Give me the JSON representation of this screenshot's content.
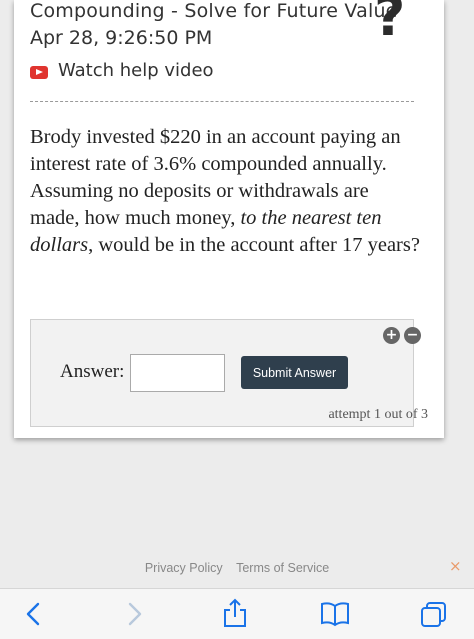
{
  "header": {
    "title": "Compounding - Solve for Future Value",
    "timestamp": "Apr 28, 9:26:50 PM",
    "help_glyph": "?",
    "watch_label": "Watch help video"
  },
  "question": {
    "part1": "Brody invested $220 in an account paying an interest rate of 3.6% compounded annually. Assuming no deposits or withdrawals are made, how much money, ",
    "emphasis": "to the nearest ten dollars",
    "part2": ", would be in the account after 17 years?"
  },
  "answer": {
    "label": "Answer:",
    "input_value": "",
    "submit_label": "Submit Answer",
    "attempt_text": "attempt 1 out of 3",
    "zoom_in_glyph": "+",
    "zoom_out_glyph": "−"
  },
  "footer": {
    "privacy_label": "Privacy Policy",
    "terms_label": "Terms of Service",
    "close_glyph": "×"
  },
  "colors": {
    "youtube_red": "#e0342f",
    "toolbar_blue": "#1a73e8",
    "submit_bg": "#2f3f4d"
  },
  "icons": {
    "back": "chevron-left-icon",
    "forward": "chevron-right-icon",
    "share": "share-icon",
    "bookmarks": "book-icon",
    "tabs": "tabs-icon"
  }
}
